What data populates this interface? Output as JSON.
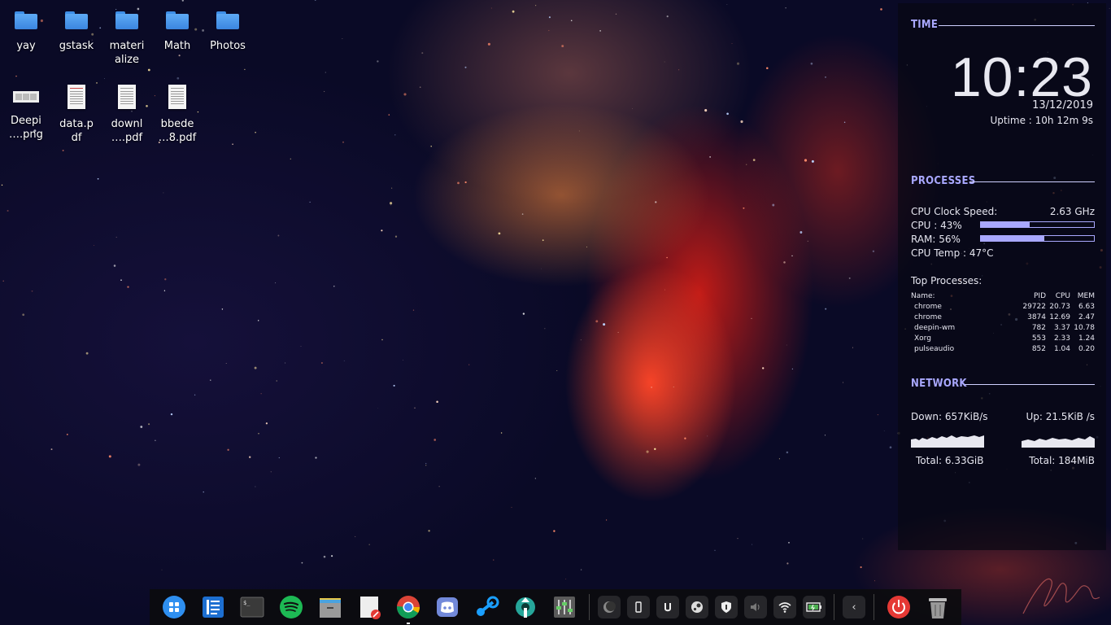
{
  "desktop": {
    "icons": [
      {
        "label": "yay",
        "type": "folder"
      },
      {
        "label": "gstask",
        "type": "folder"
      },
      {
        "label": "materi\nalize",
        "type": "folder"
      },
      {
        "label": "Math",
        "type": "folder"
      },
      {
        "label": "Photos",
        "type": "folder"
      },
      {
        "label": "Deepi\n….png",
        "type": "image"
      },
      {
        "label": "data.p\ndf",
        "type": "pdf"
      },
      {
        "label": "downl\n….pdf",
        "type": "pdf"
      },
      {
        "label": "bbede\n…8.pdf",
        "type": "pdf"
      }
    ]
  },
  "conky": {
    "time": {
      "title": "TIME",
      "clock": "10:23",
      "date": "13/12/2019",
      "uptime": "Uptime : 10h 12m 9s"
    },
    "processes": {
      "title": "PROCESSES",
      "clock_speed_label": "CPU Clock Speed:",
      "clock_speed_value": "2.63 GHz",
      "cpu_label": "CPU : 43%",
      "cpu_percent": 43,
      "ram_label": "RAM: 56%",
      "ram_percent": 56,
      "temp_label": "CPU Temp : 47°C",
      "top_title": "Top Processes:",
      "headers": {
        "name": "Name:",
        "pid": "PID",
        "cpu": "CPU",
        "mem": "MEM"
      },
      "rows": [
        {
          "name": "chrome",
          "pid": "29722",
          "cpu": "20.73",
          "mem": "6.63"
        },
        {
          "name": "chrome",
          "pid": "3874",
          "cpu": "12.69",
          "mem": "2.47"
        },
        {
          "name": "deepin-wm",
          "pid": "782",
          "cpu": "3.37",
          "mem": "10.78"
        },
        {
          "name": "Xorg",
          "pid": "553",
          "cpu": "2.33",
          "mem": "1.24"
        },
        {
          "name": "pulseaudio",
          "pid": "852",
          "cpu": "1.04",
          "mem": "0.20"
        }
      ]
    },
    "network": {
      "title": "NETWORK",
      "down": "Down: 657KiB/s",
      "up": "Up: 21.5KiB /s",
      "total_down": "Total: 6.33GiB",
      "total_up": "Total: 184MiB"
    }
  },
  "dock": {
    "apps": [
      "launcher-icon",
      "files-icon",
      "terminal-icon",
      "spotify-icon",
      "archive-manager-icon",
      "text-editor-icon",
      "chrome-icon",
      "discord-icon",
      "steam-icon",
      "settings-icon",
      "mixer-icon"
    ],
    "tray": [
      "night-mode-icon",
      "phone-icon",
      "unity-icon",
      "steam-tray-icon",
      "vpn-shield-icon",
      "volume-icon",
      "wifi-icon",
      "battery-icon"
    ],
    "collapse_glyph": "‹"
  },
  "colors": {
    "accent": "#a9a8ff",
    "folder": "#4a9af0",
    "panel": "rgba(8,8,20,0.72)"
  }
}
